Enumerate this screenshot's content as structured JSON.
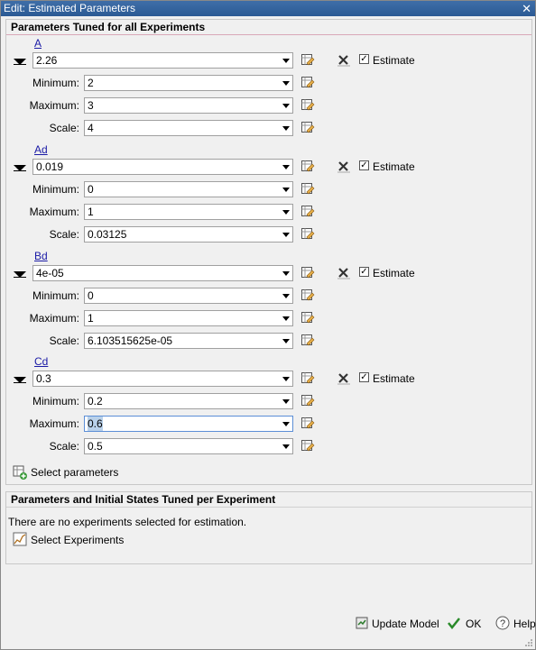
{
  "window": {
    "title": "Edit: Estimated Parameters",
    "close_glyph": "✕"
  },
  "group1": {
    "title": "Parameters Tuned for all Experiments",
    "estimate_label": "Estimate",
    "labels": {
      "min": "Minimum:",
      "max": "Maximum:",
      "scale": "Scale:"
    },
    "params": [
      {
        "name": "A",
        "value": "2.26",
        "min": "2",
        "max": "3",
        "scale": "4",
        "estimate": true
      },
      {
        "name": "Ad",
        "value": "0.019",
        "min": "0",
        "max": "1",
        "scale": "0.03125",
        "estimate": true
      },
      {
        "name": "Bd",
        "value": "4e-05",
        "min": "0",
        "max": "1",
        "scale": "6.103515625e-05",
        "estimate": true
      },
      {
        "name": "Cd",
        "value": "0.3",
        "min": "0.2",
        "max": "0.6",
        "scale": "0.5",
        "estimate": true
      }
    ],
    "select_parameters": "Select parameters"
  },
  "group2": {
    "title": "Parameters and Initial States Tuned per Experiment",
    "message": "There are no experiments selected for estimation.",
    "select_experiments": "Select Experiments"
  },
  "footer": {
    "update_model": "Update Model",
    "ok": "OK",
    "help": "Help"
  },
  "icons": {
    "edit": "edit-pencil-icon",
    "remove": "remove-x-icon",
    "add_params": "add-params-icon",
    "experiments": "experiments-icon",
    "update": "update-model-icon",
    "ok": "ok-check-icon",
    "help": "help-icon"
  }
}
